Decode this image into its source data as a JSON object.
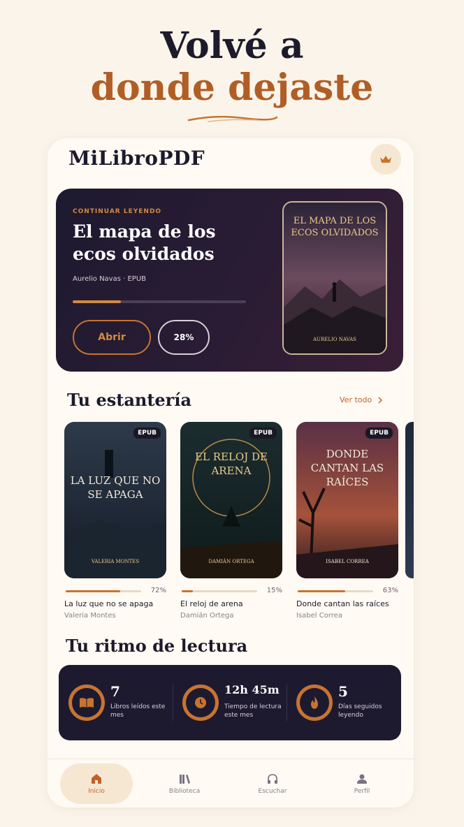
{
  "hero": {
    "line1": "Volvé a",
    "line2": "donde dejaste"
  },
  "app": {
    "brand": "MiLibroPDF",
    "premium_icon": "crown-icon"
  },
  "continue_reading": {
    "kicker": "Continuar leyendo",
    "title": "El mapa de los ecos olvidados",
    "meta": "Aurelio Navas · EPUB",
    "progress_percent": 28,
    "open_label": "Abrir",
    "percent_label": "28%",
    "cover_title": "El mapa de los ecos olvidados",
    "cover_author": "Aurelio Navas"
  },
  "shelf": {
    "title": "Tu estantería",
    "see_all": "Ver todo",
    "books": [
      {
        "badge": "EPUB",
        "cover_title": "La luz que no se apaga",
        "cover_author": "Valeria Montes",
        "title": "La luz que no se apaga",
        "author": "Valeria Montes",
        "percent": 72,
        "percent_label": "72%"
      },
      {
        "badge": "EPUB",
        "cover_title": "El reloj de arena",
        "cover_author": "Damián Ortega",
        "title": "El reloj de arena",
        "author": "Damián Ortega",
        "percent": 15,
        "percent_label": "15%"
      },
      {
        "badge": "EPUB",
        "cover_title": "Donde cantan las raíces",
        "cover_author": "Isabel Correa",
        "title": "Donde cantan las raíces",
        "author": "Isabel Correa",
        "percent": 63,
        "percent_label": "63%"
      }
    ]
  },
  "rhythm": {
    "title": "Tu ritmo de lectura",
    "stats": [
      {
        "icon": "book-icon",
        "value": "7",
        "label": "Libros leídos este mes"
      },
      {
        "icon": "clock-icon",
        "value": "12h 45m",
        "label": "Tiempo de lectura este mes"
      },
      {
        "icon": "flame-icon",
        "value": "5",
        "label": "Días seguidos leyendo"
      }
    ]
  },
  "nav": [
    {
      "label": "Inicio",
      "icon": "home-icon",
      "active": true
    },
    {
      "label": "Biblioteca",
      "icon": "library-icon",
      "active": false
    },
    {
      "label": "Escuchar",
      "icon": "headphones-icon",
      "active": false
    },
    {
      "label": "Perfil",
      "icon": "user-icon",
      "active": false
    }
  ],
  "colors": {
    "accent": "#c8742f",
    "dark": "#1d1a30",
    "background": "#fbf4ea"
  }
}
